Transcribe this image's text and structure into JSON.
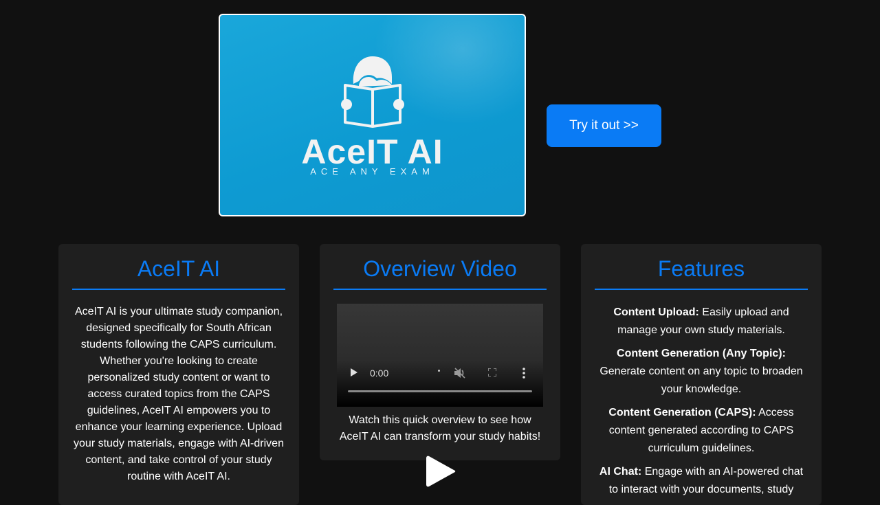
{
  "hero": {
    "logo_name": "AceIT AI",
    "logo_tagline": "ACE ANY EXAM",
    "logo_icon": "student-reading-book-icon"
  },
  "cta": {
    "label": "Try it out >>"
  },
  "about": {
    "title": "AceIT AI",
    "text": "AceIT AI is your ultimate study companion, designed specifically for South African students following the CAPS curriculum. Whether you're looking to create personalized study content or want to access curated topics from the CAPS guidelines, AceIT AI empowers you to enhance your learning experience. Upload your study materials, engage with AI-driven content, and take control of your study routine with AceIT AI."
  },
  "video": {
    "title": "Overview Video",
    "time": "0:00",
    "caption": "Watch this quick overview to see how AceIT AI can transform your study habits!"
  },
  "features": {
    "title": "Features",
    "items": [
      {
        "label": "Content Upload:",
        "text": " Easily upload and manage your own study materials."
      },
      {
        "label": "Content Generation (Any Topic):",
        "text": " Generate content on any topic to broaden your knowledge."
      },
      {
        "label": "Content Generation (CAPS):",
        "text": " Access content generated according to CAPS curriculum guidelines."
      },
      {
        "label": "AI Chat:",
        "text": " Engage with an AI-powered chat to interact with your documents, study"
      }
    ]
  },
  "colors": {
    "accent": "#0a7bf5",
    "background": "#111111",
    "card": "#1f1f1f",
    "hero": "#0e9bd2"
  }
}
